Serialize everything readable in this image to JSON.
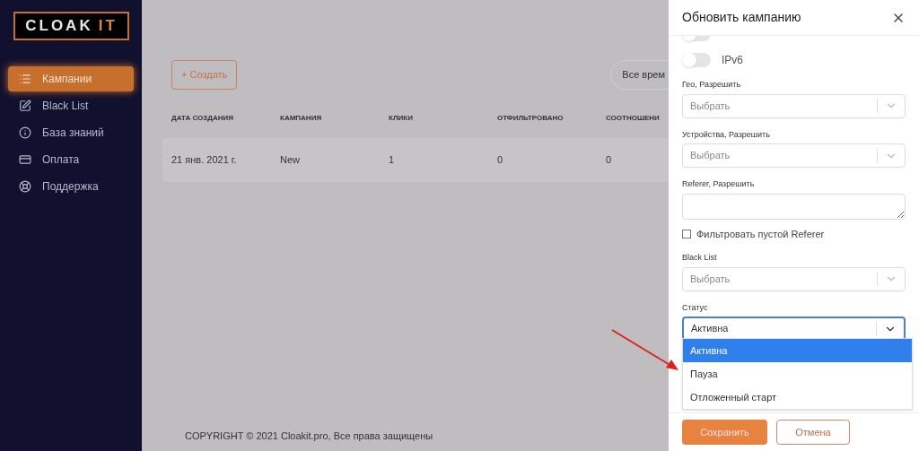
{
  "logo": {
    "text": "CLOAK",
    "accent": "IT"
  },
  "sidebar": {
    "items": [
      {
        "label": "Кампании",
        "selected": true
      },
      {
        "label": "Black List",
        "selected": false
      },
      {
        "label": "База знаний",
        "selected": false
      },
      {
        "label": "Оплата",
        "selected": false
      },
      {
        "label": "Поддержка",
        "selected": false
      }
    ]
  },
  "toolbar": {
    "create_button": "+ Создать",
    "period_filter": "Все врем"
  },
  "table": {
    "columns": [
      "ДАТА СОЗДАНИЯ",
      "КАМПАНИЯ",
      "КЛИКИ",
      "ОТФИЛЬТРОВАНО",
      "СООТНОШЕНИ"
    ],
    "rows": [
      {
        "cells": [
          "21 янв. 2021 г.",
          "New",
          "1",
          "0",
          "0"
        ]
      }
    ]
  },
  "footer": "COPYRIGHT © 2021 Cloakit.pro, Все права защищены",
  "drawer": {
    "title": "Обновить кампанию",
    "fields": [
      {
        "kind": "toggle",
        "on": false
      },
      {
        "kind": "toggle",
        "label": "IPv6",
        "on": false
      },
      {
        "kind": "select",
        "label": "Гео, Разрешить",
        "placeholder": "Выбрать"
      },
      {
        "kind": "select",
        "label": "Устройства, Разрешить",
        "placeholder": "Выбрать"
      },
      {
        "kind": "textarea",
        "label": "Referer, Разрешить"
      },
      {
        "kind": "checkbox",
        "label": "Фильтровать пустой Referer",
        "checked": false
      },
      {
        "kind": "select",
        "label": "Black List",
        "placeholder": "Выбрать"
      },
      {
        "kind": "select",
        "label": "Статус",
        "value": "Активна",
        "focused": true
      }
    ],
    "status_options": [
      {
        "label": "Активна",
        "selected": true
      },
      {
        "label": "Пауза",
        "selected": false
      },
      {
        "label": "Отложенный старт",
        "selected": false
      }
    ],
    "buttons": [
      {
        "label": "Сохранить",
        "kind": "primary"
      },
      {
        "label": "Отмена",
        "kind": "secondary"
      }
    ]
  }
}
